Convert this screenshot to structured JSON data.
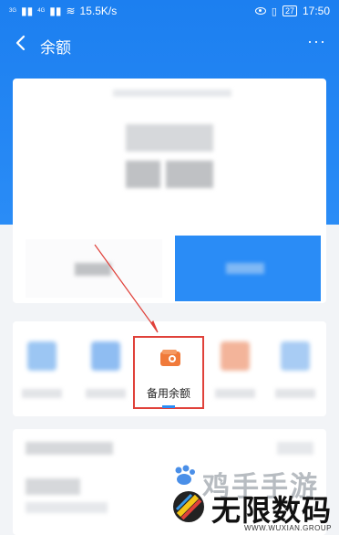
{
  "status_bar": {
    "signal_1": "3G",
    "signal_2": "4G",
    "net_speed": "15.5K/s",
    "battery": "27",
    "time": "17:50"
  },
  "nav": {
    "title": "余额",
    "more": "···"
  },
  "grid": {
    "highlight_label": "备用余额"
  },
  "watermark": {
    "hand_text": "鸡手手游",
    "brand": "无限数码",
    "url": "WWW.WUXIAN.GROUP"
  },
  "colors": {
    "primary": "#2a8cf6",
    "highlight_border": "#e0413a",
    "wallet": "#f07a3a"
  }
}
